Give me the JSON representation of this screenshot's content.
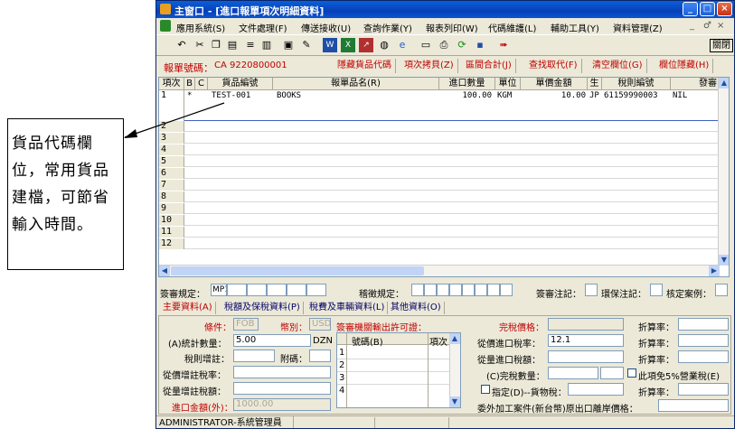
{
  "callout": {
    "text": "貨品代碼欄位，常用貨品建檔，可節省輸入時間。"
  },
  "window": {
    "title": "主窗口 - [進口報單項次明細資料]",
    "controls": [
      "_",
      "□",
      "×"
    ]
  },
  "menubar": {
    "items": [
      "應用系統(S)",
      "文件處理(F)",
      "傳送接收(U)",
      "查詢作業(Y)",
      "報表列印(W)",
      "代碼維護(L)",
      "輔助工具(Y)",
      "資料管理(Z)"
    ],
    "mdi_controls": [
      "_",
      "♂",
      "×"
    ]
  },
  "toolbar": {
    "close_label": "關閉"
  },
  "header": {
    "report_no_label": "報單號碼：",
    "report_no_value": "CA  9220800001",
    "buttons": [
      "隱藏貨品代碼",
      "項次拷貝(Z)",
      "區間合計(J)",
      "查找取代(F)",
      "清空欄位(G)",
      "欄位隱藏(H)"
    ]
  },
  "grid": {
    "columns": [
      "項次",
      "B",
      "C",
      "貨品編號",
      "報單品名(R)",
      "進口數量",
      "單位",
      "單價金額",
      "生",
      "稅則編號",
      "發審"
    ],
    "rows": [
      {
        "no": "1",
        "b": "*",
        "c": "",
        "item_code": "TEST-001",
        "name": "BOOKS",
        "qty": "100.00",
        "unit": "KGM",
        "price": "10.00",
        "origin": "JP",
        "tariff": "61159990003",
        "review": "NIL"
      },
      {
        "no": "2"
      },
      {
        "no": "3"
      },
      {
        "no": "4"
      },
      {
        "no": "5"
      },
      {
        "no": "6"
      },
      {
        "no": "7"
      },
      {
        "no": "8"
      },
      {
        "no": "9"
      },
      {
        "no": "10"
      },
      {
        "no": "11"
      },
      {
        "no": "12"
      }
    ]
  },
  "regulations": {
    "review_label": "簽審規定：",
    "review_value": "MP1",
    "inspection_label": "稽徵規定：",
    "review_note_label": "簽審注記：",
    "env_note_label": "環保注記：",
    "case_label": "核定案例："
  },
  "tabs": [
    "主要資料(A)",
    "稅額及保稅資料(P)",
    "稅費及車輛資料(L)",
    "其他資料(O)"
  ],
  "form": {
    "terms_label": "條件：",
    "terms_value": "FOB",
    "currency_label": "幣別：",
    "currency_value": "USD",
    "stat_qty_label": "(A)統計數量：",
    "stat_qty_value": "5.00",
    "stat_qty_unit": "DZN",
    "tax_note_label": "稅則增註：",
    "attached_label": "附碼：",
    "ad_val_rate_label": "從價增註稅率：",
    "specific_label": "從量增註稅額：",
    "import_amount_label": "進口金額(外)：",
    "import_amount_value": "1000.00",
    "permit_label": "簽審機關輸出許可證：",
    "permit_col_no": "號碼(B)",
    "permit_col_item": "項次",
    "permit_rows": [
      "1",
      "2",
      "3",
      "4"
    ],
    "duty_price_label": "完稅價格：",
    "ad_val_import_label": "從價進口稅率：",
    "ad_val_import_value": "12.1",
    "specific_import_label": "從量進口稅額：",
    "duty_qty_label": "(C)完稅數量：",
    "designated_label": "指定(D)--貨物稅：",
    "export_price_label": "委外加工案件(新台幣)原出口離岸價格：",
    "discount_label": "折算率：",
    "exempt_label": "此項免5%營業稅(E)"
  },
  "status": {
    "user": "ADMINISTRATOR-系統管理員"
  }
}
